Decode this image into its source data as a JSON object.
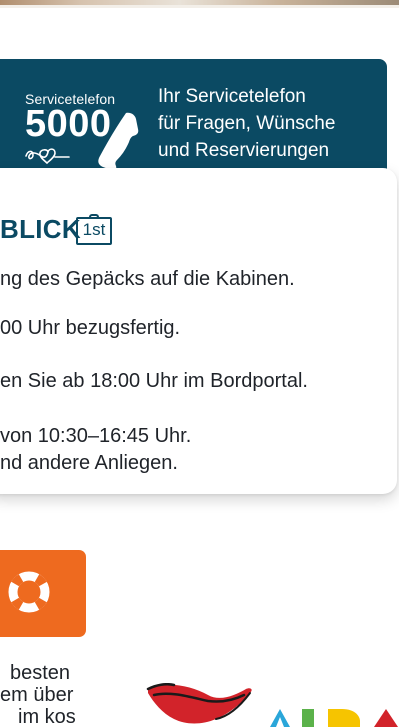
{
  "service_banner": {
    "small_label": "Servicetelefon",
    "number": "5000",
    "lines": [
      "Ihr Servicetelefon",
      "für Fragen, Wünsche",
      "und Reservierungen"
    ]
  },
  "info_card": {
    "title": "BLICK",
    "badge": "1st",
    "lines": [
      "ng des Gepäcks auf die Kabinen.",
      "00 Uhr bezugsfertig.",
      "en Sie ab 18:00 Uhr im Bordportal.",
      " von 10:30–16:45 Uhr.",
      "nd andere Anliegen."
    ]
  },
  "help_tile": {
    "icon": "lifebuoy-icon"
  },
  "bottom_text": {
    "lines": [
      "besten",
      "em über",
      "im kos"
    ]
  },
  "colors": {
    "brand_blue": "#0b4a63",
    "orange": "#ee6a1f",
    "aida_red": "#d2232a",
    "aida_yellow": "#f6c400",
    "aida_green": "#5bb24a"
  }
}
